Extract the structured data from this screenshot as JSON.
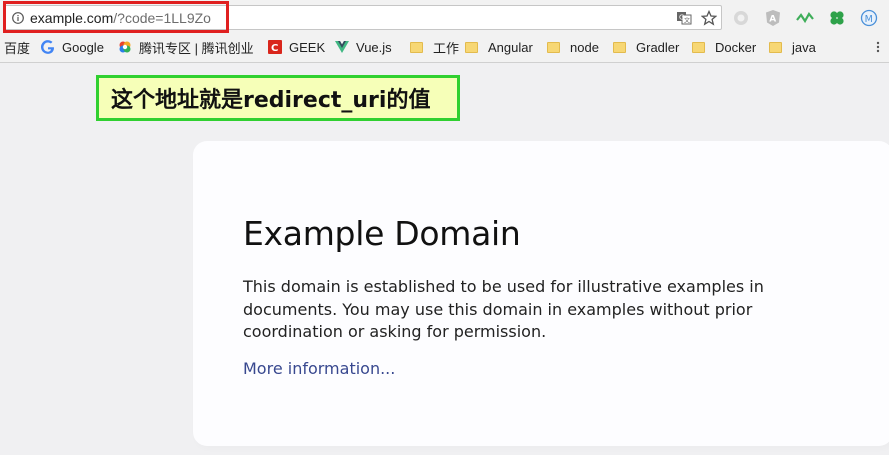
{
  "browser": {
    "url_host": "example.com",
    "url_rest": "/?code=1LL9Zo"
  },
  "bookmarks": [
    {
      "label": "百度",
      "icon": "none"
    },
    {
      "label": "Google",
      "icon": "google-icon"
    },
    {
      "label": "腾讯专区 | 腾讯创业",
      "icon": "tencent-icon"
    },
    {
      "label": "GEEK",
      "icon": "geek-icon"
    },
    {
      "label": "Vue.js",
      "icon": "vue-icon"
    },
    {
      "label": "工作",
      "icon": "folder-icon"
    },
    {
      "label": "Angular",
      "icon": "folder-icon"
    },
    {
      "label": "node",
      "icon": "folder-icon"
    },
    {
      "label": "Gradler",
      "icon": "folder-icon"
    },
    {
      "label": "Docker",
      "icon": "folder-icon"
    },
    {
      "label": "java",
      "icon": "folder-icon"
    }
  ],
  "annotation": {
    "text": "这个地址就是redirect_uri的值"
  },
  "page": {
    "title": "Example Domain",
    "body": "This domain is established to be used for illustrative examples in documents. You may use this domain in examples without prior coordination or asking for permission.",
    "link": "More information..."
  },
  "colors": {
    "highlight_border": "#e02020",
    "annotation_border": "#30d030",
    "annotation_bg": "#f6ffb8",
    "link": "#38488f",
    "page_bg": "#f0f0f2"
  }
}
